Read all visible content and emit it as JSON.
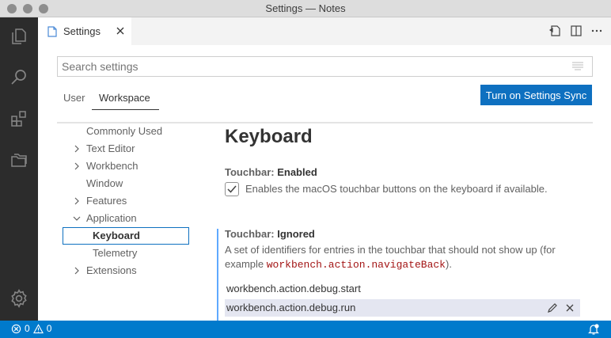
{
  "window": {
    "title": "Settings — Notes"
  },
  "activity_bar": {
    "icons": [
      "explorer-icon",
      "search-icon",
      "extensions-icon",
      "source-control-icon",
      "settings-gear-icon"
    ]
  },
  "tab": {
    "label": "Settings"
  },
  "search": {
    "placeholder": "Search settings",
    "value": ""
  },
  "scopes": {
    "user": "User",
    "workspace": "Workspace",
    "selected": "Workspace"
  },
  "sync_button": "Turn on Settings Sync",
  "toc": {
    "items": [
      {
        "label": "Commonly Used",
        "expandable": false
      },
      {
        "label": "Text Editor",
        "expandable": true
      },
      {
        "label": "Workbench",
        "expandable": true
      },
      {
        "label": "Window",
        "expandable": false
      },
      {
        "label": "Features",
        "expandable": true
      },
      {
        "label": "Application",
        "expandable": true,
        "expanded": true
      },
      {
        "label": "Keyboard",
        "child": true,
        "selected": true
      },
      {
        "label": "Telemetry",
        "child": true
      },
      {
        "label": "Extensions",
        "expandable": true
      }
    ]
  },
  "section": {
    "title": "Keyboard"
  },
  "settings": {
    "touchbar_enabled": {
      "category": "Touchbar: ",
      "key": "Enabled",
      "checked": true,
      "description": "Enables the macOS touchbar buttons on the keyboard if available."
    },
    "touchbar_ignored": {
      "category": "Touchbar: ",
      "key": "Ignored",
      "description_line1": "A set of identifiers for entries in the touchbar that should not show up (for",
      "description_prefix": "example ",
      "description_code": "workbench.action.navigateBack",
      "description_suffix": ").",
      "items": [
        "workbench.action.debug.start",
        "workbench.action.debug.run"
      ]
    }
  },
  "status_bar": {
    "errors": "0",
    "warnings": "0"
  },
  "colors": {
    "accent": "#007acc",
    "button": "#0e70c0",
    "activity_bar": "#2c2c2c",
    "code": "#a31515"
  }
}
